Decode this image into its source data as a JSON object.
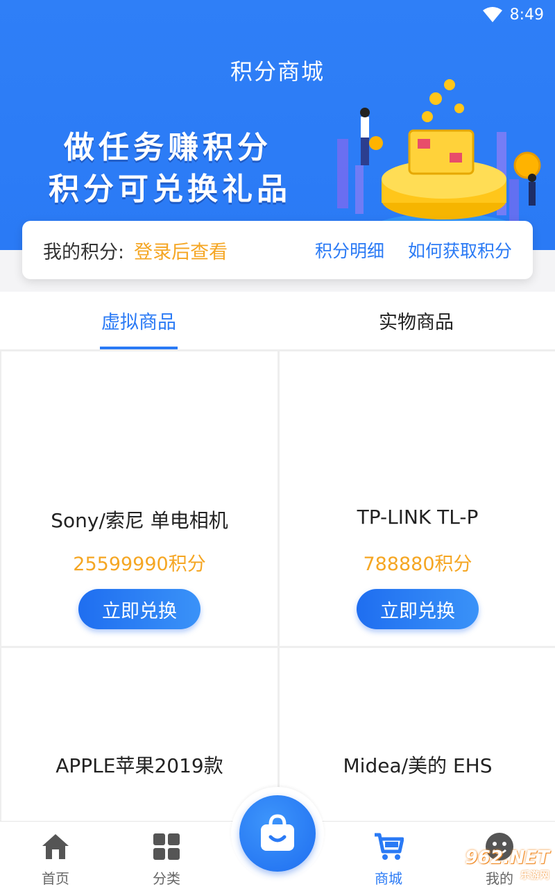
{
  "status_bar": {
    "time": "8:49"
  },
  "header": {
    "title": "积分商城",
    "banner_line1": "做任务赚积分",
    "banner_line2": "积分可兑换礼品"
  },
  "points": {
    "label": "我的积分:",
    "value": "登录后查看",
    "detail_link": "积分明细",
    "how_link": "如何获取积分"
  },
  "tabs": [
    {
      "label": "虚拟商品",
      "active": true
    },
    {
      "label": "实物商品",
      "active": false
    }
  ],
  "products": [
    {
      "name": "Sony/索尼 单电相机",
      "price": "25599990积分",
      "button": "立即兑换"
    },
    {
      "name": "TP-LINK TL-P",
      "price": "788880积分",
      "button": "立即兑换"
    },
    {
      "name": "APPLE苹果2019款"
    },
    {
      "name": "Midea/美的 EHS"
    }
  ],
  "bottom_nav": [
    {
      "label": "首页",
      "icon": "home-icon"
    },
    {
      "label": "分类",
      "icon": "grid-icon"
    },
    {
      "label": "商城",
      "icon": "cart-icon",
      "active": true
    },
    {
      "label": "我的",
      "icon": "smiley-icon"
    }
  ],
  "watermark": {
    "brand": "962.NET",
    "sub": "乐游网"
  },
  "colors": {
    "primary": "#2a7af5",
    "accent": "#f5a623"
  }
}
